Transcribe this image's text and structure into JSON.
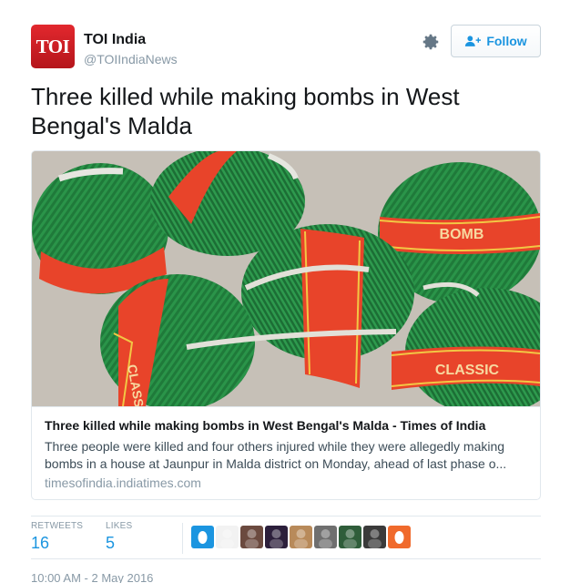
{
  "user": {
    "avatar_text": "TOI",
    "name": "TOI India",
    "handle": "@TOIIndiaNews",
    "follow_label": "Follow"
  },
  "tweet": {
    "text": "Three killed while making bombs in West Bengal's Malda",
    "timestamp": "10:00 AM - 2 May 2016"
  },
  "card": {
    "image_alt": "green thread-wrapped country bombs with red 'BOMB' and 'CLASSIC' labels",
    "image_labels": [
      "BOMB",
      "CLASSIC",
      "CLASS"
    ],
    "title": "Three killed while making bombs in West Bengal's Malda - Times of India",
    "description_line1": "Three people were killed and four others injured while they were allegedly making",
    "description_line2": "bombs in a house at Jaunpur in Malda district on Monday, ahead of last phase o...",
    "domain": "timesofindia.indiatimes.com"
  },
  "stats": {
    "retweets_label": "RETWEETS",
    "retweets_value": "16",
    "likes_label": "LIKES",
    "likes_value": "5"
  },
  "likers": [
    {
      "name": "liker-1",
      "color": "#1b95e0"
    },
    {
      "name": "liker-2",
      "color": "#f2f2f2"
    },
    {
      "name": "liker-3",
      "color": "#6b4a3f"
    },
    {
      "name": "liker-4",
      "color": "#2c1f3b"
    },
    {
      "name": "liker-5",
      "color": "#b88a5a"
    },
    {
      "name": "liker-6",
      "color": "#6f6f6f"
    },
    {
      "name": "liker-7",
      "color": "#2f5d3a"
    },
    {
      "name": "liker-8",
      "color": "#3a3a3a"
    },
    {
      "name": "liker-9",
      "color": "#f06a2c"
    }
  ],
  "colors": {
    "accent": "#1b95e0",
    "toi_red": "#d0232a",
    "muted": "#8899a6"
  },
  "icons": {
    "settings": "gear-icon",
    "follow": "add-user-icon"
  }
}
